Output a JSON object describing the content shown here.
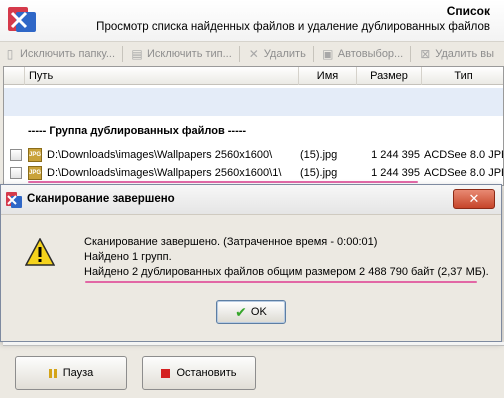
{
  "header": {
    "title": "Список",
    "subtitle": "Просмотр списка найденных файлов и удаление дублированных файлов"
  },
  "toolbar": {
    "items": [
      {
        "label": "Исключить папку...",
        "icon": "exclude-folder-icon"
      },
      {
        "label": "Исключить тип...",
        "icon": "exclude-type-icon"
      },
      {
        "label": "Удалить",
        "icon": "delete-icon"
      },
      {
        "label": "Автовыбор...",
        "icon": "auto-select-icon"
      },
      {
        "label": "Удалить вы",
        "icon": "delete-selected-icon"
      }
    ]
  },
  "table": {
    "columns": [
      "Путь",
      "Имя",
      "Размер",
      "Тип"
    ],
    "group_title": "----- Группа дублированных файлов -----",
    "rows": [
      {
        "path": "D:\\Downloads\\images\\Wallpapers 2560x1600\\",
        "name": "(15).jpg",
        "size": "1 244 395",
        "type": "ACDSee 8.0 JPE"
      },
      {
        "path": "D:\\Downloads\\images\\Wallpapers 2560x1600\\1\\",
        "name": "(15).jpg",
        "size": "1 244 395",
        "type": "ACDSee 8.0 JPE"
      }
    ]
  },
  "dialog": {
    "title": "Сканирование завершено",
    "line1": "Сканирование завершено. (Затраченное время - 0:00:01)",
    "line2": "Найдено 1 групп.",
    "line3": "Найдено 2 дублированных файлов общим размером 2 488 790 байт (2,37 МБ).",
    "ok_label": "OK"
  },
  "buttons": {
    "pause_label": "Пауза",
    "stop_label": "Остановить"
  },
  "colors": {
    "accent_underline": "#e0509a",
    "selection_row": "#e4ecf8",
    "close_button": "#c6452a"
  }
}
